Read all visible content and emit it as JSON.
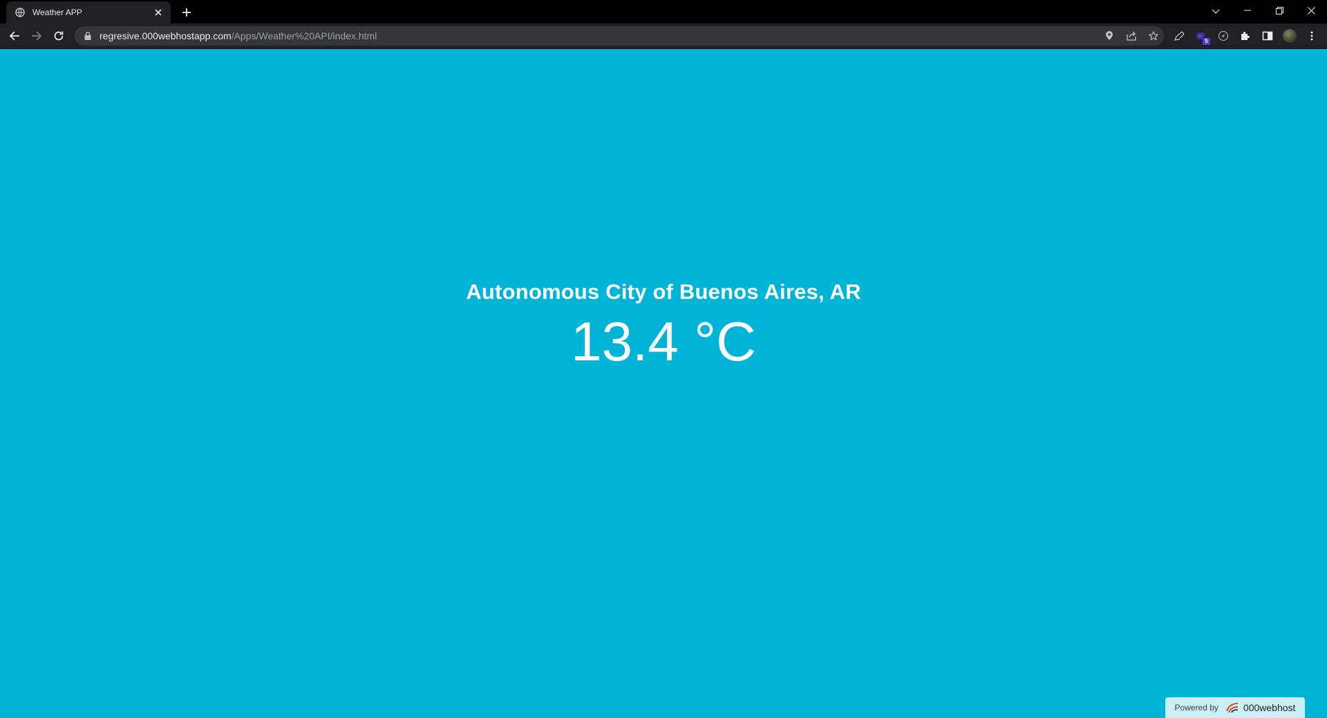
{
  "browser": {
    "tab_title": "Weather APP",
    "url_host": "regresive.000webhostapp.com",
    "url_path": "/Apps/Weather%20API/index.html",
    "extension_badge": "5"
  },
  "weather": {
    "city": "Autonomous City of Buenos Aires, AR",
    "temperature": "13.4 °C"
  },
  "footer": {
    "powered_by": "Powered by",
    "brand": "000webhost"
  },
  "colors": {
    "page_background": "#00b4d8",
    "text": "#ffffff"
  },
  "icons": [
    "globe-icon",
    "close-icon",
    "plus-icon",
    "chevron-down-icon",
    "minimize-icon",
    "restore-icon",
    "back-arrow-icon",
    "forward-arrow-icon",
    "reload-icon",
    "lock-icon",
    "location-pin-icon",
    "share-icon",
    "star-icon",
    "pen-icon",
    "extension-icon",
    "compass-icon",
    "puzzle-icon",
    "side-panel-icon",
    "kebab-menu-icon",
    "webhost-logo-icon"
  ]
}
